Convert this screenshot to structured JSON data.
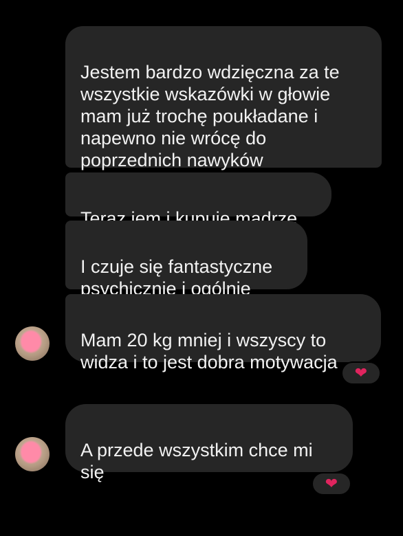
{
  "messages": [
    {
      "text": "Jestem bardzo wdzięczna za te\nwszystkie wskazówki w głowie\nmam już trochę poukładane i\nnapewno nie wrócę do\npoprzednich nawyków"
    },
    {
      "text": "Teraz jem i kupuje mądrze"
    },
    {
      "text": "I czuje się fantastyczne\npsychicznie i ogólnie"
    },
    {
      "text": "Mam 20 kg mniej i wszyscy to\nwidza i to jest dobra motywacja",
      "reaction": "❤"
    },
    {
      "text": "A przede wszystkim chce mi\nsię",
      "reaction": "❤"
    }
  ],
  "colors": {
    "background": "#000000",
    "bubble": "#262626",
    "text": "#f2f2f2",
    "heart": "#e0245e"
  },
  "icons": {
    "reaction": "heart-icon",
    "avatar": "sender-avatar"
  }
}
